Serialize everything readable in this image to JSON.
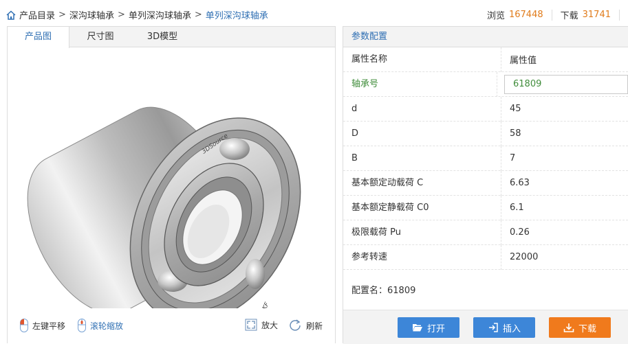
{
  "breadcrumb": {
    "items": [
      "产品目录",
      "深沟球轴承",
      "单列深沟球轴承",
      "单列深沟球轴承"
    ],
    "separator": ">"
  },
  "stats": {
    "views_label": "浏览",
    "views_value": "167448",
    "downloads_label": "下载",
    "downloads_value": "31741"
  },
  "tabs": [
    {
      "label": "产品图",
      "active": true
    },
    {
      "label": "尺寸图",
      "active": false
    },
    {
      "label": "3D模型",
      "active": false
    }
  ],
  "model": {
    "rim_text_top": "3DSource",
    "rim_text_bottom": "SKF"
  },
  "viewer_controls": {
    "left_pan": "左键平移",
    "scroll_zoom": "滚轮缩放",
    "zoom_in": "放大",
    "refresh": "刷新"
  },
  "config_panel": {
    "title": "参数配置",
    "header": {
      "name": "属性名称",
      "value": "属性值"
    },
    "bearing": {
      "name": "轴承号",
      "value": "61809"
    },
    "rows": [
      {
        "name": "d",
        "value": "45"
      },
      {
        "name": "D",
        "value": "58"
      },
      {
        "name": "B",
        "value": "7"
      },
      {
        "name": "基本额定动载荷 C",
        "value": "6.63"
      },
      {
        "name": "基本额定静载荷 C0",
        "value": "6.1"
      },
      {
        "name": "极限载荷 Pu",
        "value": "0.26"
      },
      {
        "name": "参考转速",
        "value": "22000"
      }
    ],
    "config_name": "配置名：61809"
  },
  "buttons": {
    "open": "打开",
    "insert": "插入",
    "download": "下载"
  },
  "colors": {
    "accent_blue": "#2f6fb3",
    "button_blue": "#3d86d8",
    "button_orange": "#f07a1c",
    "count_orange": "#e07b1a",
    "bearing_green": "#3f8c3a"
  },
  "icons": [
    "home-icon",
    "mouse-left-icon",
    "mouse-scroll-icon",
    "zoom-in-icon",
    "refresh-icon",
    "folder-open-icon",
    "insert-icon",
    "download-icon"
  ]
}
